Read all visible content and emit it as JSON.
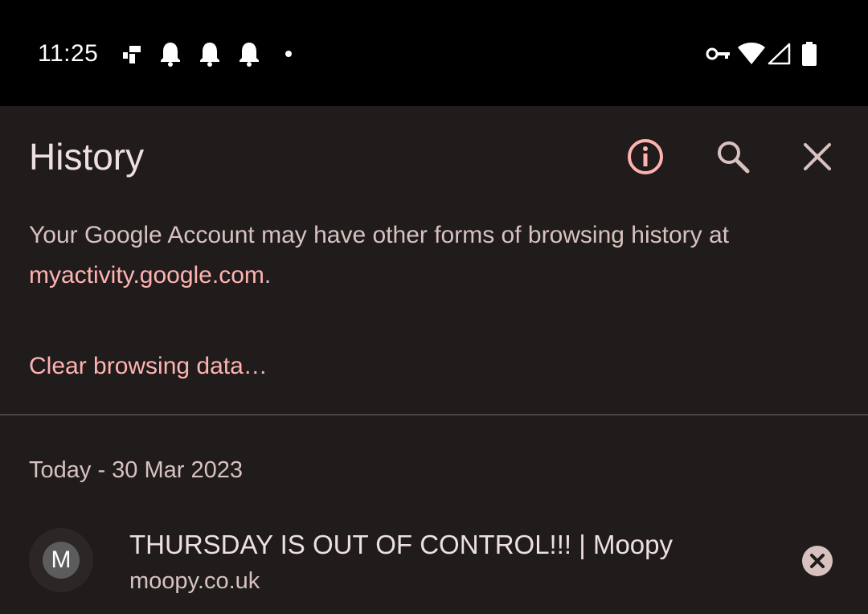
{
  "status_bar": {
    "time": "11:25",
    "left_icons": [
      "app-notification-icon",
      "bell-icon",
      "bell-icon",
      "bell-icon",
      "more-notifications-dot-icon"
    ],
    "right_icons": [
      "vpn-key-icon",
      "wifi-icon",
      "cellular-signal-icon",
      "battery-icon"
    ]
  },
  "header": {
    "title": "History",
    "actions": [
      "info-icon",
      "search-icon",
      "close-icon"
    ]
  },
  "info": {
    "text": "Your Google Account may have other forms of browsing history at ",
    "link": "myactivity.google.com",
    "suffix": "."
  },
  "clear_link": "Clear browsing data…",
  "history": {
    "section_header": "Today - 30 Mar 2023",
    "items": [
      {
        "favicon_letter": "M",
        "title": "THURSDAY IS OUT OF CONTROL!!! | Moopy",
        "url": "moopy.co.uk"
      }
    ]
  },
  "colors": {
    "background": "#201c1c",
    "status_bar": "#000000",
    "accent": "#ffb3b0",
    "primary_text": "#ede0de",
    "secondary_text": "#d8c2bf"
  }
}
